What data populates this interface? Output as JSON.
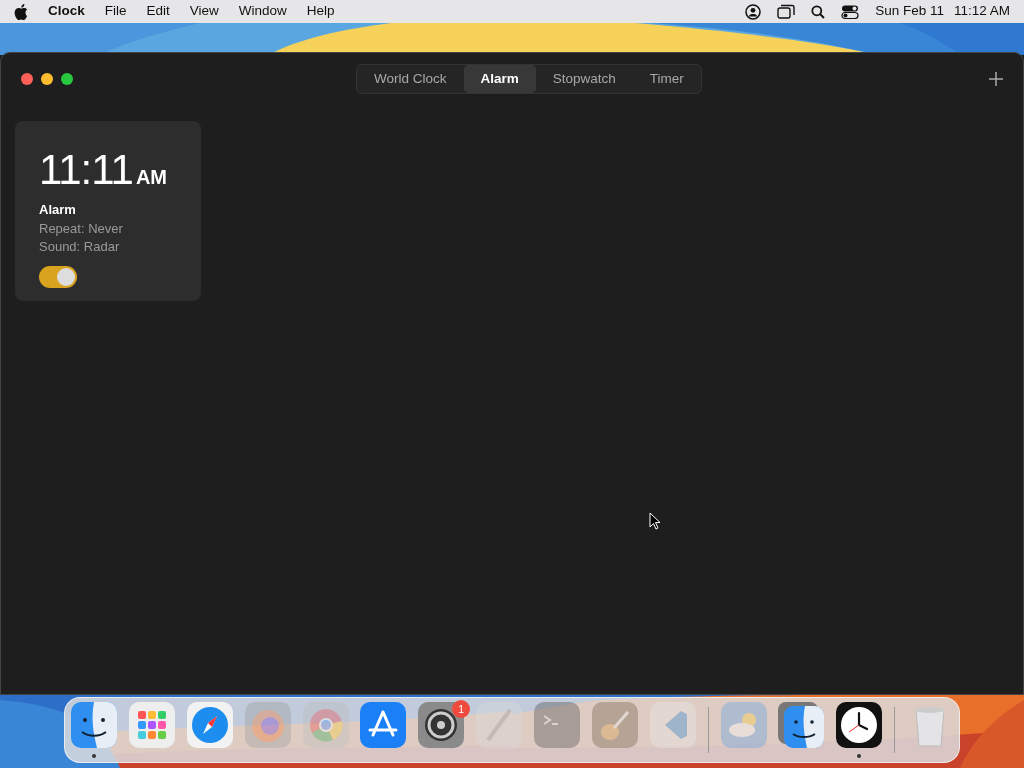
{
  "menu_bar": {
    "app_name": "Clock",
    "menus": [
      "File",
      "Edit",
      "View",
      "Window",
      "Help"
    ],
    "date": "Sun Feb 11",
    "time": "11:12 AM"
  },
  "window": {
    "tabs": [
      {
        "label": "World Clock",
        "selected": false
      },
      {
        "label": "Alarm",
        "selected": true
      },
      {
        "label": "Stopwatch",
        "selected": false
      },
      {
        "label": "Timer",
        "selected": false
      }
    ],
    "alarms": [
      {
        "time": "11:11",
        "period": "AM",
        "label": "Alarm",
        "repeat": "Repeat: Never",
        "sound": "Sound: Radar",
        "on": true
      }
    ]
  },
  "dock": {
    "items": [
      {
        "kind": "app",
        "running": true,
        "dimmed": false
      },
      {
        "kind": "app",
        "running": false,
        "dimmed": false
      },
      {
        "kind": "app",
        "running": false,
        "dimmed": false
      },
      {
        "kind": "app",
        "running": false,
        "dimmed": true
      },
      {
        "kind": "app",
        "running": false,
        "dimmed": true
      },
      {
        "kind": "app",
        "running": false,
        "dimmed": false
      },
      {
        "kind": "app",
        "running": false,
        "dimmed": false,
        "badge": "1"
      },
      {
        "kind": "app",
        "running": false,
        "dimmed": true
      },
      {
        "kind": "app",
        "running": false,
        "dimmed": true
      },
      {
        "kind": "app",
        "running": false,
        "dimmed": true
      },
      {
        "kind": "app",
        "running": false,
        "dimmed": true
      },
      {
        "kind": "separator"
      },
      {
        "kind": "app",
        "running": false,
        "dimmed": true
      },
      {
        "kind": "app",
        "running": false,
        "dimmed": false
      },
      {
        "kind": "app",
        "running": true,
        "dimmed": false
      },
      {
        "kind": "separator"
      },
      {
        "kind": "app",
        "running": false,
        "dimmed": false
      }
    ]
  }
}
